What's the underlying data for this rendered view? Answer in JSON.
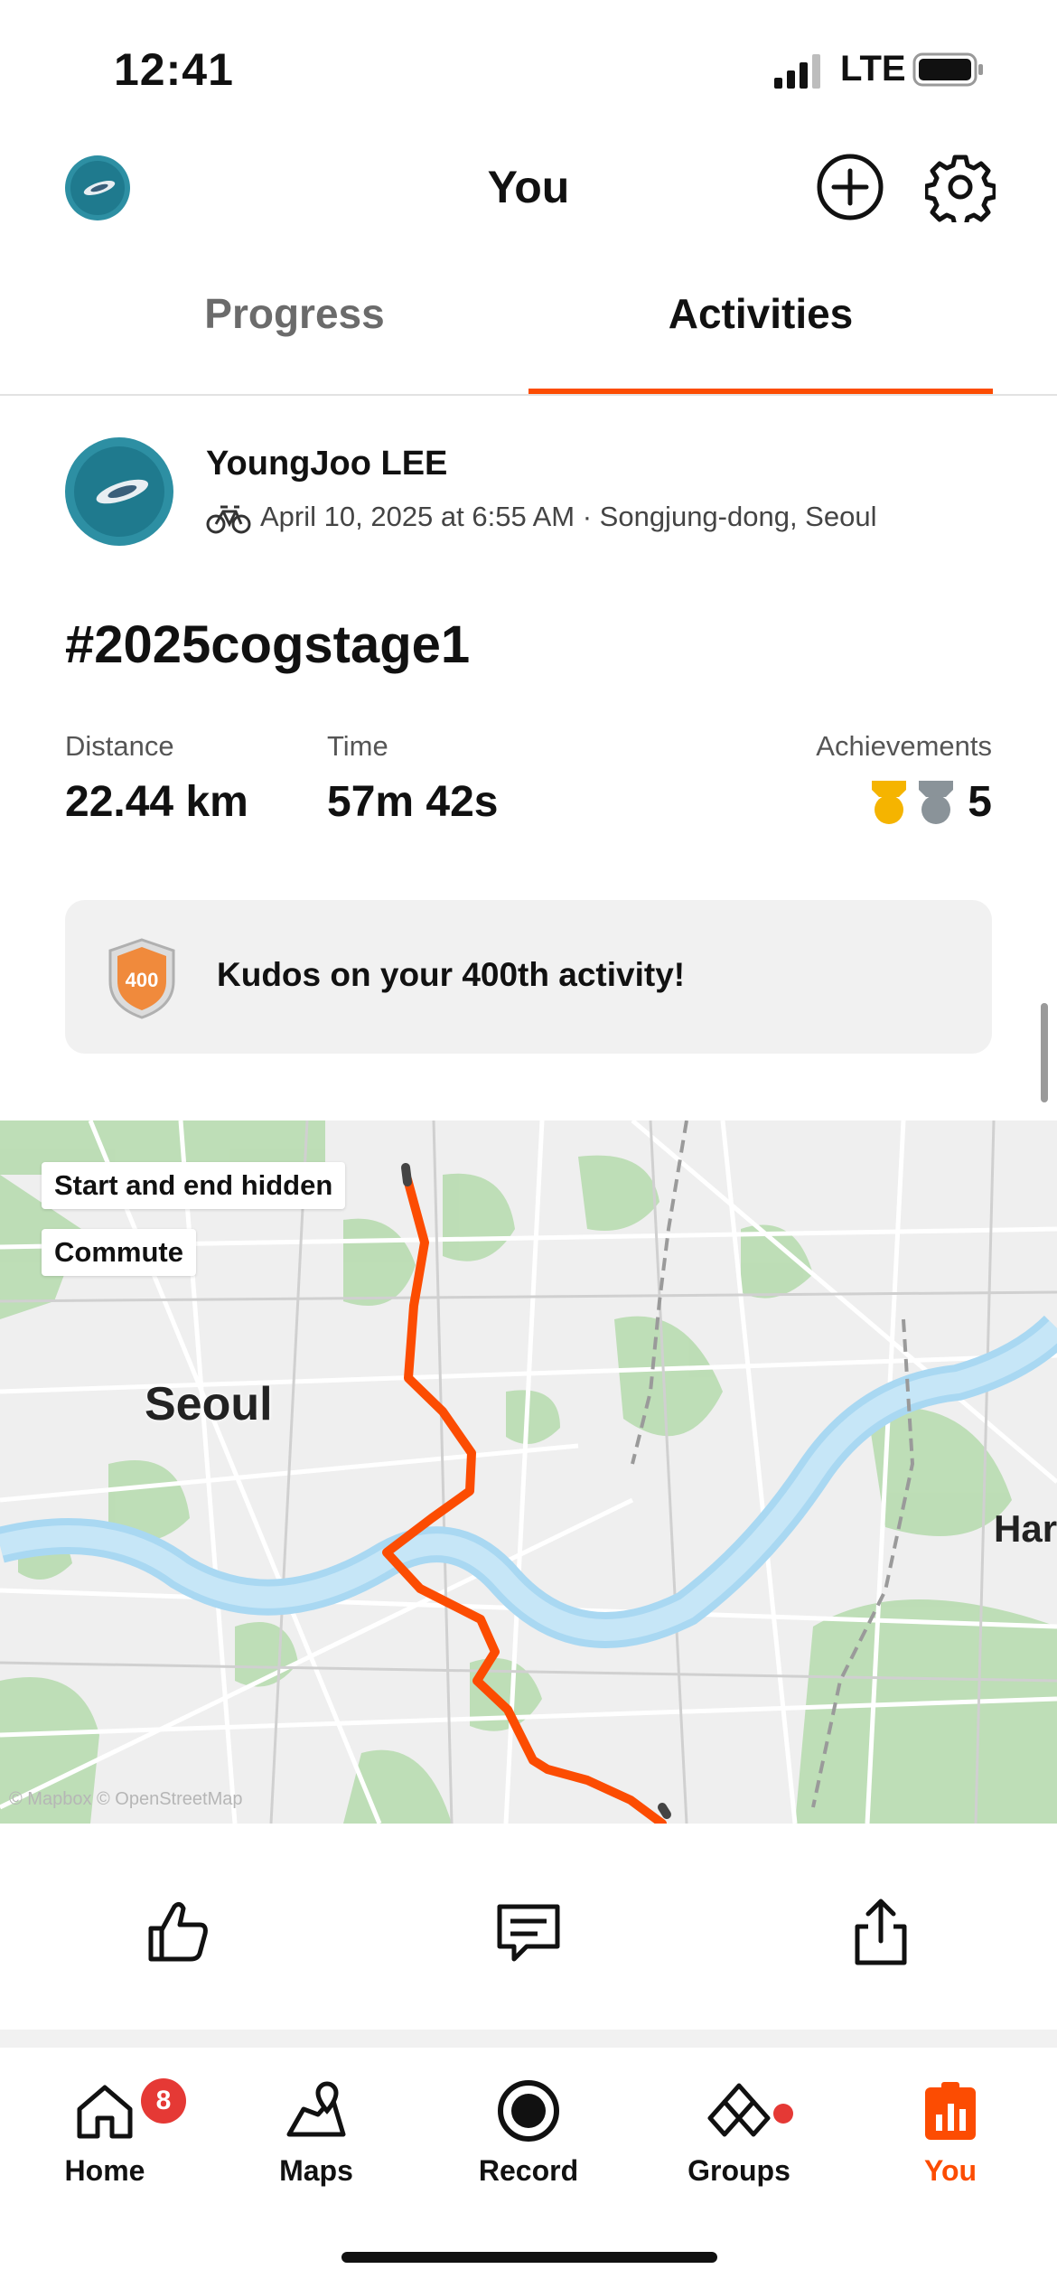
{
  "status_bar": {
    "time": "12:41",
    "network": "LTE"
  },
  "header": {
    "title": "You"
  },
  "tabs": [
    {
      "label": "Progress",
      "active": false
    },
    {
      "label": "Activities",
      "active": true
    }
  ],
  "activity": {
    "athlete": "YoungJoo LEE",
    "meta": "April 10, 2025 at 6:55 AM · Songjung-dong, Seoul",
    "title": "#2025cogstage1",
    "stats": {
      "distance_label": "Distance",
      "distance_value": "22.44 km",
      "time_label": "Time",
      "time_value": "57m 42s",
      "achievements_label": "Achievements",
      "achievements_count": "5"
    },
    "kudos_banner": {
      "badge_text": "400",
      "message": "Kudos on your 400th activity!"
    }
  },
  "map": {
    "chips": {
      "privacy": "Start and end hidden",
      "commute": "Commute"
    },
    "labels": {
      "city": "Seoul",
      "partial_city": "Har"
    },
    "attribution": "© Mapbox © OpenStreetMap",
    "route_color": "#fc4c02"
  },
  "actions": {
    "kudos_icon": "thumbs-up-icon",
    "comment_icon": "comment-icon",
    "share_icon": "share-icon"
  },
  "nav": {
    "items": [
      {
        "label": "Home",
        "badge": "8"
      },
      {
        "label": "Maps"
      },
      {
        "label": "Record"
      },
      {
        "label": "Groups"
      },
      {
        "label": "You",
        "active": true
      }
    ],
    "accent": "#fc4c02"
  }
}
